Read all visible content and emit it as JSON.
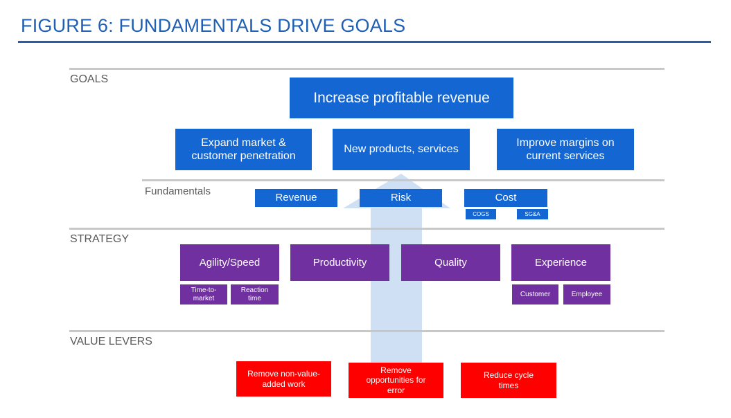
{
  "title": "FIGURE 6:  FUNDAMENTALS DRIVE GOALS",
  "sections": {
    "goals": "GOALS",
    "fundamentals": "Fundamentals",
    "strategy": "STRATEGY",
    "value_levers": "VALUE LEVERS"
  },
  "goals": {
    "main": "Increase profitable revenue",
    "sub": [
      "Expand market & customer penetration",
      "New products, services",
      "Improve margins on current services"
    ]
  },
  "fundamentals": {
    "items": [
      "Revenue",
      "Risk",
      "Cost"
    ],
    "cost_sub": [
      "COGS",
      "SG&A"
    ]
  },
  "strategy": {
    "items": [
      "Agility/Speed",
      "Productivity",
      "Quality",
      "Experience"
    ],
    "agility_sub": [
      "Time-to-market",
      "Reaction time"
    ],
    "experience_sub": [
      "Customer",
      "Employee"
    ]
  },
  "value_levers": [
    "Remove non-value-added work",
    "Remove opportunities for error",
    "Reduce cycle times"
  ],
  "colors": {
    "title": "#1f5fb4",
    "blue": "#1466d2",
    "purple": "#7030a0",
    "red": "#ff0000",
    "arrow": "#cfe0f4",
    "rule": "#c8c8c8"
  }
}
